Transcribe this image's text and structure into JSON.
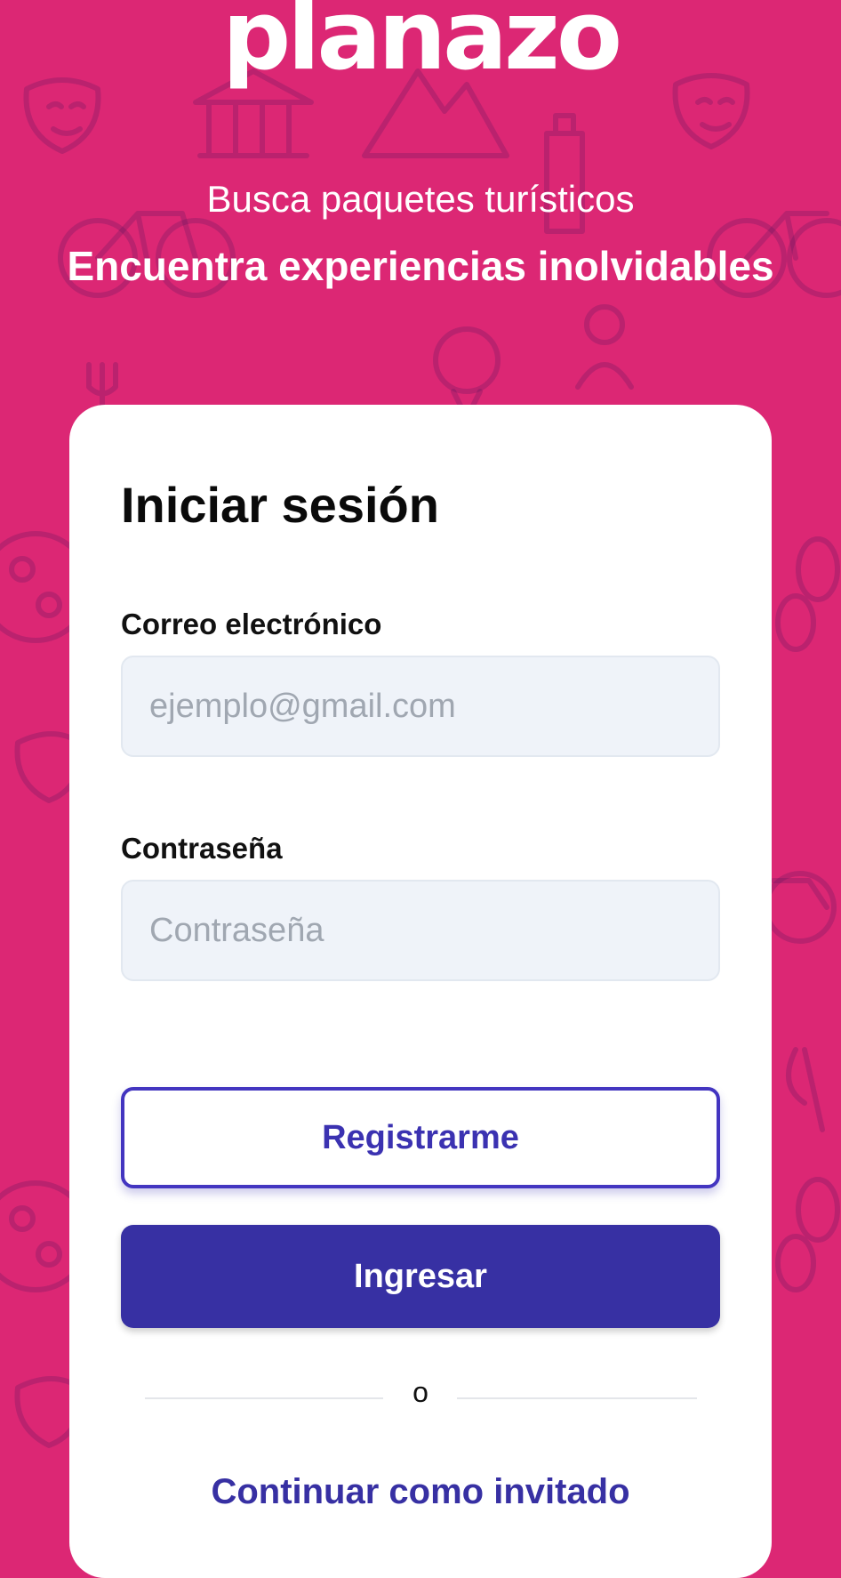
{
  "brand": {
    "logo_text": "planazo"
  },
  "hero": {
    "tagline_line1": "Busca paquetes turísticos",
    "tagline_line2": "Encuentra experiencias inolvidables"
  },
  "login_card": {
    "title": "Iniciar sesión",
    "email": {
      "label": "Correo electrónico",
      "placeholder": "ejemplo@gmail.com",
      "value": ""
    },
    "password": {
      "label": "Contraseña",
      "placeholder": "Contraseña",
      "value": ""
    },
    "register_button_label": "Registrarme",
    "login_button_label": "Ingresar",
    "divider_text": "o",
    "guest_link_label": "Continuar como invitado"
  },
  "colors": {
    "background": "#dc2774",
    "primary": "#3730a3",
    "card": "#ffffff",
    "input_background": "#eff3f9"
  }
}
